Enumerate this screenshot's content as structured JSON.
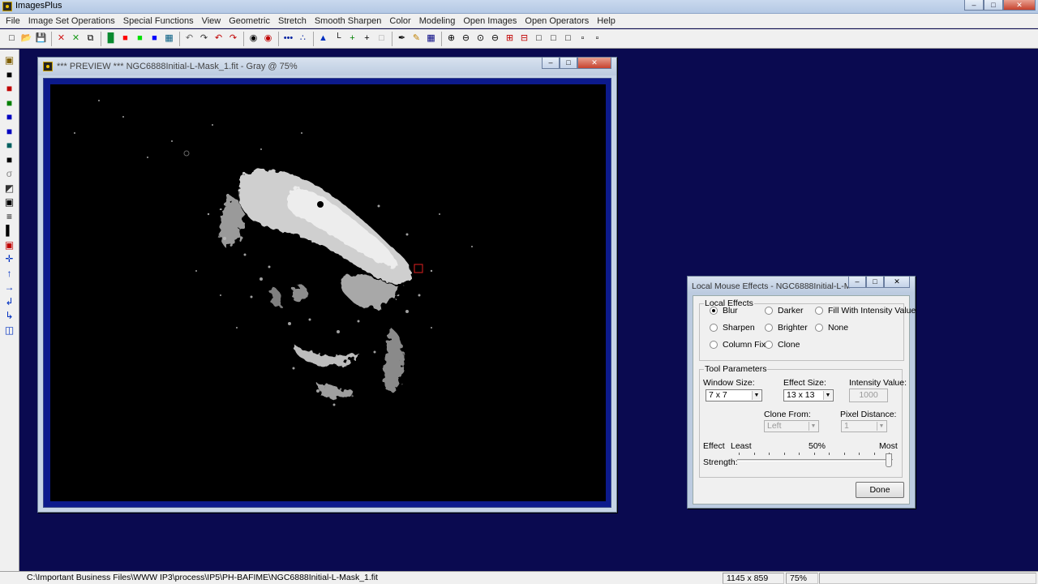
{
  "app": {
    "title": "ImagesPlus",
    "caption_min": "–",
    "caption_max": "□",
    "caption_close": "✕"
  },
  "menu": [
    "File",
    "Image Set Operations",
    "Special Functions",
    "View",
    "Geometric",
    "Stretch",
    "Smooth Sharpen",
    "Color",
    "Modeling",
    "Open Images",
    "Open Operators",
    "Help"
  ],
  "toolbar": {
    "icons": [
      {
        "name": "new-icon",
        "glyph": "□"
      },
      {
        "name": "open-icon",
        "glyph": "📂"
      },
      {
        "name": "save-icon",
        "glyph": "💾"
      },
      {
        "name": "close-red-icon",
        "glyph": "✕",
        "color": "#d01818"
      },
      {
        "name": "close-green-icon",
        "glyph": "✕",
        "color": "#1a9a1a"
      },
      {
        "name": "copy-icon",
        "glyph": "⧉"
      },
      {
        "name": "rgb-channels-icon",
        "glyph": "█",
        "color": "#0a8a30"
      },
      {
        "name": "red-channel-icon",
        "glyph": "■",
        "color": "#ff0000"
      },
      {
        "name": "green-channel-icon",
        "glyph": "■",
        "color": "#00e000"
      },
      {
        "name": "blue-channel-icon",
        "glyph": "■",
        "color": "#0000ff"
      },
      {
        "name": "grid-icon",
        "glyph": "▦",
        "color": "#005a80"
      },
      {
        "name": "undo-icon",
        "glyph": "↶",
        "color": "#666666"
      },
      {
        "name": "redo-icon",
        "glyph": "↷",
        "color": "#333333"
      },
      {
        "name": "undo-all-icon",
        "glyph": "↶",
        "color": "#c00000"
      },
      {
        "name": "redo-all-icon",
        "glyph": "↷",
        "color": "#c00000"
      },
      {
        "name": "record-icon",
        "glyph": "◉",
        "color": "#000000"
      },
      {
        "name": "record-red-icon",
        "glyph": "◉",
        "color": "#c00000"
      },
      {
        "name": "dots-line-icon",
        "glyph": "•••",
        "color": "#0020a0"
      },
      {
        "name": "points-icon",
        "glyph": "∴",
        "color": "#0020a0"
      },
      {
        "name": "histogram-icon",
        "glyph": "▲",
        "color": "#0030c0"
      },
      {
        "name": "axes-icon",
        "glyph": "└",
        "color": "#000000"
      },
      {
        "name": "plus-green-icon",
        "glyph": "+",
        "color": "#008000"
      },
      {
        "name": "crosshair-icon",
        "glyph": "+",
        "color": "#000000"
      },
      {
        "name": "frame-icon",
        "glyph": "□",
        "color": "#999999"
      },
      {
        "name": "paint-icon",
        "glyph": "✒",
        "color": "#000000"
      },
      {
        "name": "pencil-icon",
        "glyph": "✎",
        "color": "#c08000"
      },
      {
        "name": "grid-blue-icon",
        "glyph": "▦",
        "color": "#000080"
      },
      {
        "name": "zoom-in-icon",
        "glyph": "⊕",
        "color": "#000000"
      },
      {
        "name": "zoom-out-icon",
        "glyph": "⊖",
        "color": "#000000"
      },
      {
        "name": "zoom-fit-icon",
        "glyph": "⊙",
        "color": "#000000"
      },
      {
        "name": "zoom-actual-icon",
        "glyph": "⊖",
        "color": "#000000"
      },
      {
        "name": "add-red-icon",
        "glyph": "⊞",
        "color": "#c00000"
      },
      {
        "name": "remove-red-icon",
        "glyph": "⊟",
        "color": "#c00000"
      },
      {
        "name": "window1-icon",
        "glyph": "□",
        "color": "#000000"
      },
      {
        "name": "window2-icon",
        "glyph": "□",
        "color": "#000000"
      },
      {
        "name": "window3-icon",
        "glyph": "□",
        "color": "#000000"
      },
      {
        "name": "window4-icon",
        "glyph": "▫",
        "color": "#000000"
      },
      {
        "name": "window5-icon",
        "glyph": "▫",
        "color": "#000000"
      }
    ]
  },
  "left_toolbar": [
    {
      "name": "save-icon",
      "glyph": "▣",
      "color": "#806000"
    },
    {
      "name": "black-square-icon",
      "glyph": "■",
      "color": "#000000"
    },
    {
      "name": "red-overlay-icon",
      "glyph": "■",
      "color": "#c00000"
    },
    {
      "name": "green-overlay-icon",
      "glyph": "■",
      "color": "#008000"
    },
    {
      "name": "blue-overlay-icon",
      "glyph": "■",
      "color": "#0000c0"
    },
    {
      "name": "blue-overlay2-icon",
      "glyph": "■",
      "color": "#0000c0"
    },
    {
      "name": "teal-overlay-icon",
      "glyph": "■",
      "color": "#006060"
    },
    {
      "name": "shadow-square-icon",
      "glyph": "■",
      "color": "#000000"
    },
    {
      "name": "lasso-icon",
      "glyph": "σ",
      "color": "#888888"
    },
    {
      "name": "gradient-icon",
      "glyph": "◩",
      "color": "#333333"
    },
    {
      "name": "select-rect-icon",
      "glyph": "▣",
      "color": "#000000"
    },
    {
      "name": "bars-icon",
      "glyph": "≡",
      "color": "#000000"
    },
    {
      "name": "black-bar-icon",
      "glyph": "▌",
      "color": "#000000"
    },
    {
      "name": "red-select-icon",
      "glyph": "▣",
      "color": "#c00000"
    },
    {
      "name": "move-icon",
      "glyph": "✛",
      "color": "#0030c0"
    },
    {
      "name": "arrow-up-icon",
      "glyph": "↑",
      "color": "#0030c0"
    },
    {
      "name": "arrow-right-icon",
      "glyph": "→",
      "color": "#0030c0"
    },
    {
      "name": "rotate-left-icon",
      "glyph": "↲",
      "color": "#0030c0"
    },
    {
      "name": "rotate-right-icon",
      "glyph": "↳",
      "color": "#0030c0"
    },
    {
      "name": "flip-icon",
      "glyph": "◫",
      "color": "#0030c0"
    }
  ],
  "preview": {
    "title": "*** PREVIEW *** NGC6888Initial-L-Mask_1.fit - Gray @ 75%"
  },
  "dialog": {
    "title": "Local Mouse Effects - NGC6888Initial-L-M...",
    "local_effects_label": "Local Effects",
    "effects": [
      {
        "label": "Blur",
        "checked": true
      },
      {
        "label": "Darker",
        "checked": false
      },
      {
        "label": "Fill With Intensity Value",
        "checked": false
      },
      {
        "label": "Sharpen",
        "checked": false
      },
      {
        "label": "Brighter",
        "checked": false
      },
      {
        "label": "None",
        "checked": false
      },
      {
        "label": "Column Fix",
        "checked": false
      },
      {
        "label": "Clone",
        "checked": false
      }
    ],
    "tool_params_label": "Tool Parameters",
    "window_size_label": "Window Size:",
    "window_size_value": "7 x 7",
    "effect_size_label": "Effect Size:",
    "effect_size_value": "13 x 13",
    "intensity_label": "Intensity Value:",
    "intensity_value": "1000",
    "clone_from_label": "Clone From:",
    "clone_from_value": "Left",
    "pixel_distance_label": "Pixel Distance:",
    "pixel_distance_value": "1",
    "effect_label": "Effect",
    "strength_label": "Strength:",
    "least_label": "Least",
    "mid_label": "50%",
    "most_label": "Most",
    "strength_fraction": 1.0,
    "done_label": "Done"
  },
  "status": {
    "path": "C:\\Important Business Files\\WWW IP3\\process\\IP5\\PH-BAFIME\\NGC6888Initial-L-Mask_1.fit",
    "dimensions": "1145 x 859",
    "zoom": "75%"
  }
}
